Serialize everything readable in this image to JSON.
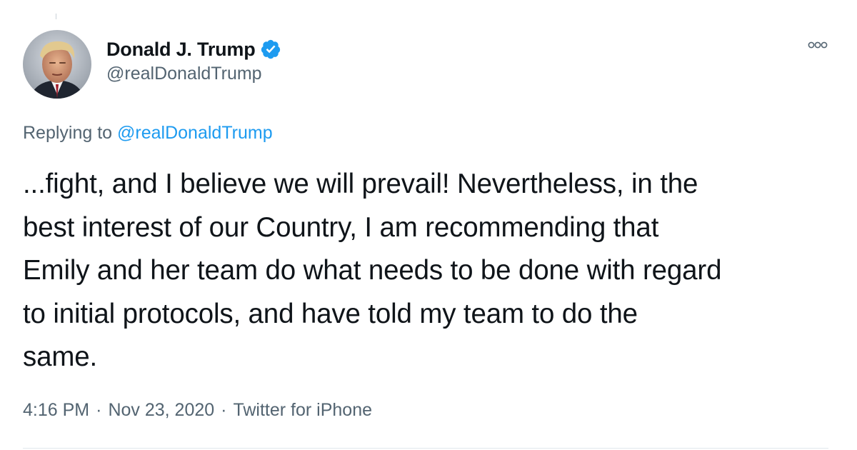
{
  "tweet": {
    "author": {
      "display_name": "Donald J. Trump",
      "handle": "@realDonaldTrump",
      "verified": true
    },
    "replying_to": {
      "prefix": "Replying to",
      "mention": "@realDonaldTrump"
    },
    "body_lines": [
      "...fight, and I believe we will prevail! Nevertheless, in the",
      "best interest of our Country, I am recommending that",
      "Emily and her team do what needs to be done with regard",
      "to initial protocols, and have told my team to do the",
      "same."
    ],
    "meta": {
      "time": "4:16 PM",
      "separator": "·",
      "date": "Nov 23, 2020",
      "source": "Twitter for iPhone"
    }
  },
  "icons": {
    "verified": "verified-badge-icon",
    "more": "more-options-icon"
  },
  "colors": {
    "accent": "#1d9bf0",
    "text_primary": "#0f1419",
    "text_secondary": "#536471",
    "divider": "#e1e8ed"
  }
}
